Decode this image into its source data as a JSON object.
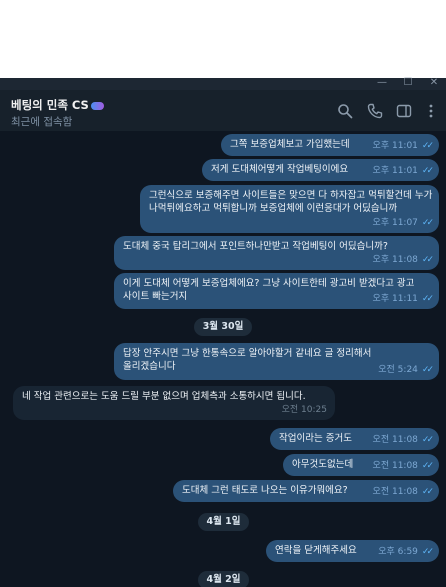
{
  "window": {
    "minimize_glyph": "—",
    "maximize_glyph": "☐",
    "close_glyph": "✕"
  },
  "header": {
    "title": "베팅의 민족 CS",
    "status": "최근에 접속함",
    "icons": [
      "search-icon",
      "phone-icon",
      "sidebar-toggle-icon",
      "more-vertical-icon"
    ]
  },
  "messages": [
    {
      "dir": "out",
      "text": "그쪽 보증업체보고 가입했는데",
      "time": "오후 11:01",
      "check": "✓✓"
    },
    {
      "dir": "out",
      "text": "저게 도대체어떻게 작업베팅이에요",
      "time": "오후 11:01",
      "check": "✓✓"
    },
    {
      "dir": "out",
      "text": "그런식으로 보증해주면 사이트들은 맞으면 다 하자잡고 먹튀할건데 누가 나먹튀에요하고 먹튀합니까 보증업체에 이런응대가 어딨습니까",
      "time": "오후 11:07",
      "check": "✓✓"
    },
    {
      "dir": "out",
      "text": "도대체 중국 탑리그에서 포인트하나만받고 작업베팅이 어딨습니까?",
      "time": "오후 11:08",
      "check": "✓✓"
    },
    {
      "dir": "out",
      "text": "이게 도대체 어떻게 보증업체에요? 그냥 사이트한테 광고비 받겠다고 광고사이트 빠는거지",
      "time": "오후 11:11",
      "check": "✓✓"
    },
    {
      "dir": "date",
      "text": "3월 30일"
    },
    {
      "dir": "out",
      "text": "답장 안주시면 그냥 한통속으로 알아야할거 같네요 글 정리해서올리겠습니다",
      "time": "오전 5:24",
      "check": "✓✓"
    },
    {
      "dir": "in",
      "text": "네 작업 관련으로는 도움 드릴 부분 없으며 업체측과 소통하시면 됩니다.",
      "time": "오전 10:25"
    },
    {
      "dir": "out",
      "text": "작업이라는 증거도",
      "time": "오전 11:08",
      "check": "✓✓"
    },
    {
      "dir": "out",
      "text": "아무것도없는데",
      "time": "오전 11:08",
      "check": "✓✓"
    },
    {
      "dir": "out",
      "text": "도대체 그런 태도로 나오는 이유가뭐에요?",
      "time": "오전 11:08",
      "check": "✓✓"
    },
    {
      "dir": "date",
      "text": "4월 1일"
    },
    {
      "dir": "out",
      "text": "연락을 닫게해주세요",
      "time": "오후 6:59",
      "check": "✓✓"
    },
    {
      "dir": "date",
      "text": "4월 2일"
    }
  ]
}
